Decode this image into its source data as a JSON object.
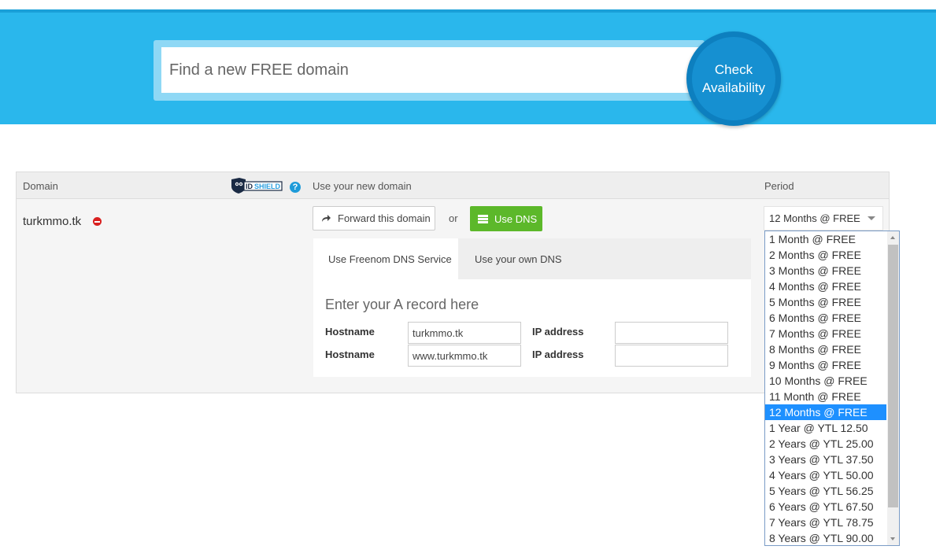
{
  "search": {
    "placeholder": "Find a new FREE domain",
    "button_line1": "Check",
    "button_line2": "Availability"
  },
  "colors": {
    "brand_blue": "#2ab7ec",
    "green_button": "#5cb82a",
    "selected_option": "#1e90ff",
    "remove_red": "#d9201f"
  },
  "table": {
    "headers": {
      "domain": "Domain",
      "use_domain": "Use your new domain",
      "period": "Period"
    },
    "idshield_logo": "IDSHIELD",
    "help_icon": "?",
    "row": {
      "domain": "turkmmo.tk",
      "forward_button": "Forward this domain",
      "or_text": "or",
      "dns_button": "Use DNS"
    }
  },
  "dns": {
    "tabs": [
      "Use Freenom DNS Service",
      "Use your own DNS"
    ],
    "a_record_title": "Enter your A record here",
    "records": [
      {
        "hostname_label": "Hostname",
        "hostname_value": "turkmmo.tk",
        "ip_label": "IP address",
        "ip_value": ""
      },
      {
        "hostname_label": "Hostname",
        "hostname_value": "www.turkmmo.tk",
        "ip_label": "IP address",
        "ip_value": ""
      }
    ]
  },
  "period": {
    "selected": "12 Months @ FREE",
    "options": [
      "1 Month @ FREE",
      "2 Months @ FREE",
      "3 Months @ FREE",
      "4 Months @ FREE",
      "5 Months @ FREE",
      "6 Months @ FREE",
      "7 Months @ FREE",
      "8 Months @ FREE",
      "9 Months @ FREE",
      "10 Months @ FREE",
      "11 Month @ FREE",
      "12 Months @ FREE",
      "1 Year @ YTL 12.50",
      "2 Years @ YTL 25.00",
      "3 Years @ YTL 37.50",
      "4 Years @ YTL 50.00",
      "5 Years @ YTL 56.25",
      "6 Years @ YTL 67.50",
      "7 Years @ YTL 78.75",
      "8 Years @ YTL 90.00"
    ]
  }
}
